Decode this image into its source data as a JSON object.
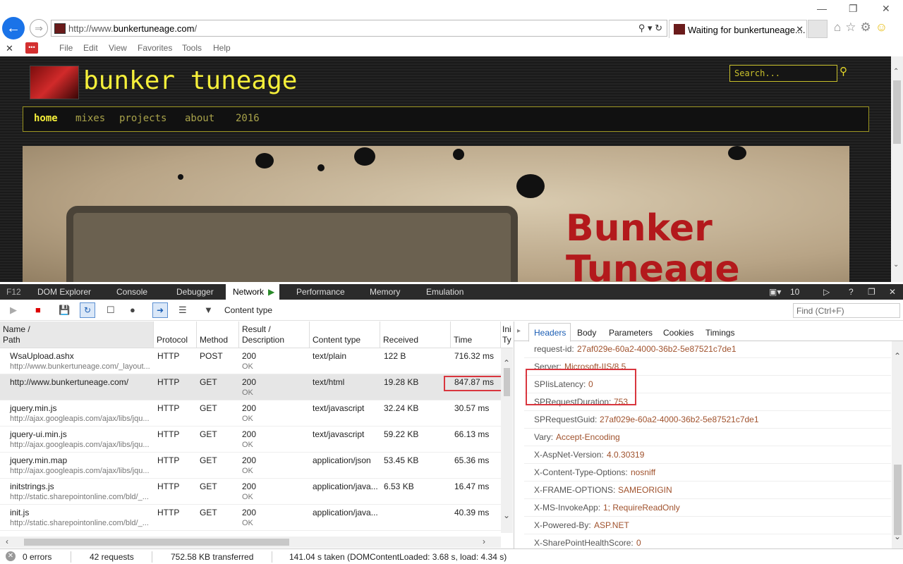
{
  "browser": {
    "url_prefix": "http://www.",
    "url_domain": "bunkertuneage.com",
    "url_suffix": "/",
    "tab_title": "Waiting for bunkertuneage....",
    "menu": [
      "File",
      "Edit",
      "View",
      "Favorites",
      "Tools",
      "Help"
    ]
  },
  "site": {
    "logo_text": "bunker tuneage",
    "search_placeholder": "Search...",
    "nav": [
      "home",
      "mixes",
      "projects",
      "about",
      "2016"
    ],
    "hero_text_1": "Bunker",
    "hero_text_2": "Tuneage"
  },
  "devtools": {
    "f12": "F12",
    "tabs": [
      "DOM Explorer",
      "Console",
      "Debugger",
      "Network",
      "Performance",
      "Memory",
      "Emulation"
    ],
    "active_tab": "Network",
    "doc_mode": "10",
    "content_type_filter": "Content type",
    "find_placeholder": "Find (Ctrl+F)",
    "columns": {
      "name": "Name /",
      "path": "Path",
      "protocol": "Protocol",
      "method": "Method",
      "result": "Result /",
      "description": "Description",
      "content_type": "Content type",
      "received": "Received",
      "time": "Time",
      "initiator": "Ini",
      "initiator_type": "Ty"
    },
    "requests": [
      {
        "name": "WsaUpload.ashx",
        "path": "http://www.bunkertuneage.com/_layout...",
        "protocol": "HTTP",
        "method": "POST",
        "result": "200",
        "desc": "OK",
        "ctype": "text/plain",
        "received": "122 B",
        "time": "716.32 ms"
      },
      {
        "name": "http://www.bunkertuneage.com/",
        "path": "",
        "protocol": "HTTP",
        "method": "GET",
        "result": "200",
        "desc": "OK",
        "ctype": "text/html",
        "received": "19.28 KB",
        "time": "847.87 ms"
      },
      {
        "name": "jquery.min.js",
        "path": "http://ajax.googleapis.com/ajax/libs/jqu...",
        "protocol": "HTTP",
        "method": "GET",
        "result": "200",
        "desc": "OK",
        "ctype": "text/javascript",
        "received": "32.24 KB",
        "time": "30.57 ms"
      },
      {
        "name": "jquery-ui.min.js",
        "path": "http://ajax.googleapis.com/ajax/libs/jqu...",
        "protocol": "HTTP",
        "method": "GET",
        "result": "200",
        "desc": "OK",
        "ctype": "text/javascript",
        "received": "59.22 KB",
        "time": "66.13 ms"
      },
      {
        "name": "jquery.min.map",
        "path": "http://ajax.googleapis.com/ajax/libs/jqu...",
        "protocol": "HTTP",
        "method": "GET",
        "result": "200",
        "desc": "OK",
        "ctype": "application/json",
        "received": "53.45 KB",
        "time": "65.36 ms"
      },
      {
        "name": "initstrings.js",
        "path": "http://static.sharepointonline.com/bld/_...",
        "protocol": "HTTP",
        "method": "GET",
        "result": "200",
        "desc": "OK",
        "ctype": "application/java...",
        "received": "6.53 KB",
        "time": "16.47 ms"
      },
      {
        "name": "init.js",
        "path": "http://static.sharepointonline.com/bld/_...",
        "protocol": "HTTP",
        "method": "GET",
        "result": "200",
        "desc": "OK",
        "ctype": "application/java...",
        "received": "",
        "time": "40.39 ms"
      }
    ],
    "detail_tabs": [
      "Headers",
      "Body",
      "Parameters",
      "Cookies",
      "Timings"
    ],
    "headers": [
      {
        "k": "request-id:",
        "v": "27af029e-60a2-4000-36b2-5e87521c7de1"
      },
      {
        "k": "Server:",
        "v": "Microsoft-IIS/8.5"
      },
      {
        "k": "SPIisLatency:",
        "v": "0"
      },
      {
        "k": "SPRequestDuration:",
        "v": "753"
      },
      {
        "k": "SPRequestGuid:",
        "v": "27af029e-60a2-4000-36b2-5e87521c7de1"
      },
      {
        "k": "Vary:",
        "v": "Accept-Encoding"
      },
      {
        "k": "X-AspNet-Version:",
        "v": "4.0.30319"
      },
      {
        "k": "X-Content-Type-Options:",
        "v": "nosniff"
      },
      {
        "k": "X-FRAME-OPTIONS:",
        "v": "SAMEORIGIN"
      },
      {
        "k": "X-MS-InvokeApp:",
        "v": "1; RequireReadOnly"
      },
      {
        "k": "X-Powered-By:",
        "v": "ASP.NET"
      },
      {
        "k": "X-SharePointHealthScore:",
        "v": "0"
      }
    ],
    "status": {
      "errors": "0 errors",
      "requests": "42 requests",
      "transferred": "752.58 KB transferred",
      "taken": "141.04 s taken (DOMContentLoaded: 3.68 s, load: 4.34 s)"
    }
  }
}
